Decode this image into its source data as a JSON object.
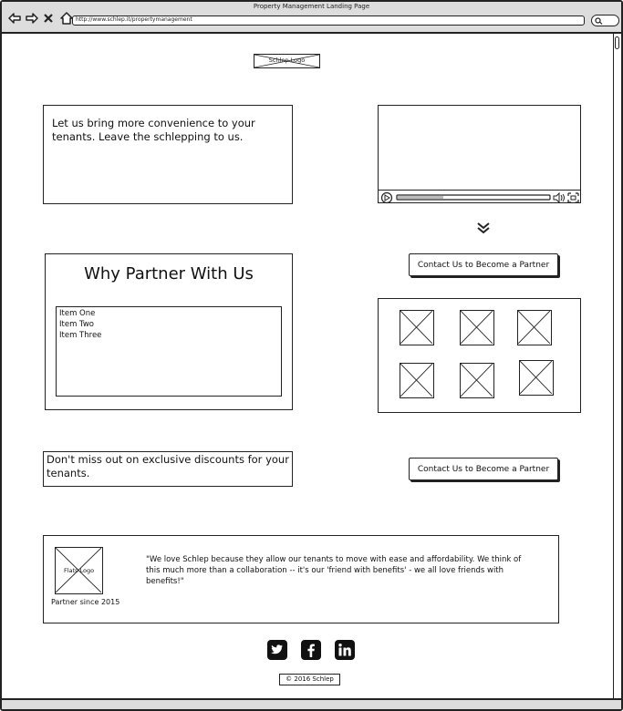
{
  "window": {
    "title": "Property Management Landing Page",
    "url": "http://www.schlep.it/propertymanagement"
  },
  "header": {
    "logo_label": "Schlep Logo"
  },
  "hero": {
    "tagline": "Let us bring more convenience to your tenants. Leave the schlepping to us."
  },
  "why_partner": {
    "title": "Why Partner With Us",
    "items": [
      "Item One",
      "Item Two",
      "Item Three"
    ]
  },
  "cta": {
    "primary_label": "Contact Us to Become a Partner",
    "secondary_label": "Contact Us to Become a Partner"
  },
  "discount": {
    "text": "Don't miss out on exclusive discounts for your tenants."
  },
  "testimonial": {
    "logo_label": "Flats Logo",
    "partner_since": "Partner since 2015",
    "quote": "\"We love Schlep because they allow our tenants to move with ease and affordability. We think of this much more than a collaboration -- it's our 'friend with benefits' - we all love friends with benefits!\""
  },
  "social": {
    "icons": [
      "twitter-icon",
      "facebook-icon",
      "linkedin-icon"
    ]
  },
  "footer": {
    "copyright": "© 2016 Schlep"
  }
}
